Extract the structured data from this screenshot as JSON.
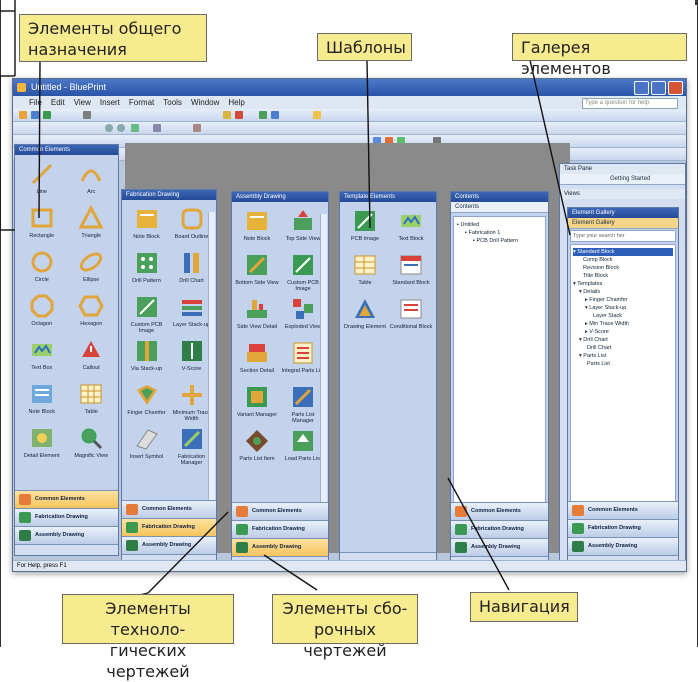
{
  "callouts": {
    "common": [
      "Элементы общего",
      "назначения"
    ],
    "templates": "Шаблоны",
    "gallery": "Галерея элементов",
    "fabrication": [
      "Элементы техноло-",
      "гических чертежей"
    ],
    "assembly": [
      "Элементы сбо-",
      "рочных чертежей"
    ],
    "navigation": "Навигация"
  },
  "app": {
    "title": "Untitled - BluePrint",
    "menu": [
      "File",
      "Edit",
      "View",
      "Insert",
      "Format",
      "Tools",
      "Window",
      "Help"
    ],
    "help_placeholder": "Type a question for help",
    "status": "For Help, press F1"
  },
  "bars": {
    "common": "Common Elements",
    "fabrication": "Fabrication Drawing",
    "assembly": "Assembly Drawing"
  },
  "panes": {
    "common": {
      "title": "Common Elements",
      "items": [
        "Line",
        "Arc",
        "Rectangle",
        "Triangle",
        "Circle",
        "Ellipse",
        "Octagon",
        "Hexagon",
        "Text Box",
        "Callout",
        "Note Block",
        "Table",
        "Detail Element",
        "Magnific View"
      ]
    },
    "fabrication": {
      "title": "Fabrication Drawing",
      "items": [
        "Note Block",
        "Board Outline",
        "Drill Pattern",
        "Drill Chart",
        "Custom PCB Image",
        "Layer Stack-up",
        "Via Stack-up",
        "V-Score",
        "Finger Chamfer",
        "Minimum Trace Width",
        "Insert Symbol",
        "Fabrication Manager"
      ]
    },
    "assembly": {
      "title": "Assembly Drawing",
      "items": [
        "Note Block",
        "Top Side View",
        "Bottom Side View",
        "Custom PCB Image",
        "Side View Detail",
        "Exploded View",
        "Section Detail",
        "Integral Parts List",
        "Variant Manager",
        "Parts List Manager",
        "Parts List Item",
        "Load Parts List"
      ]
    },
    "templates": {
      "title": "Template Elements",
      "items": [
        "PCB Image",
        "Text Block",
        "Table",
        "Standard Block",
        "Drawing Element",
        "Conditional Block"
      ]
    },
    "contents": {
      "title": "Contents",
      "sub": "Contents",
      "tree": [
        "Untitled",
        "Fabrication 1",
        "PCB Drill Pattern"
      ]
    },
    "gallery": {
      "tasks_title": "Task Pane",
      "getting_started": "Getting Started",
      "views": "Views",
      "title": "Element Gallery",
      "sub": "Element Gallery",
      "search": "Type your search her",
      "tree": [
        "Standard Block",
        "Comp Block",
        "Revision Block",
        "Title Block",
        "Templates",
        "Details",
        "Finger Chamfer",
        "Layer Stack-up",
        "Layer Stack",
        "Min Trace Width",
        "V-Score",
        "Drill Chart",
        "Drill Chart",
        "Parts List",
        "Parts List"
      ]
    }
  }
}
